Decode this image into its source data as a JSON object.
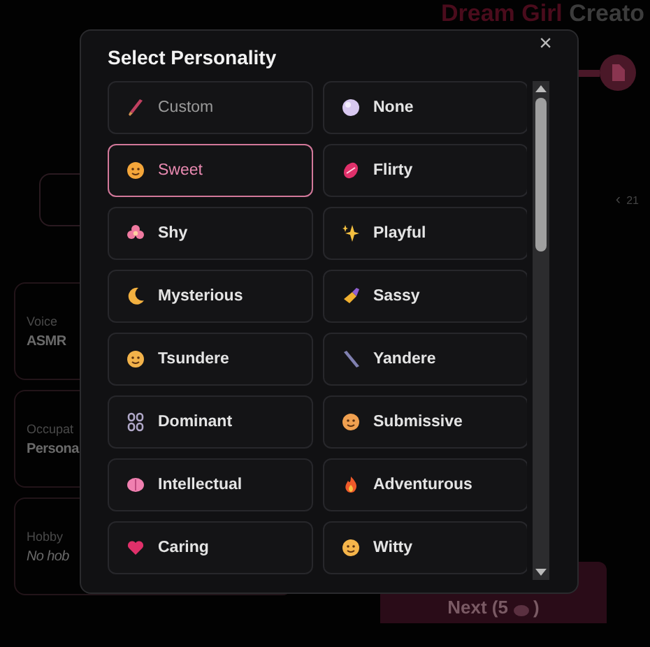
{
  "page": {
    "title_part1": "Dream Girl",
    "title_part2": "Creato",
    "pager": {
      "prev": "‹",
      "page": "21"
    },
    "fields": [
      {
        "label": "Voice",
        "value": "ASMR",
        "kind": "value"
      },
      {
        "label": "Occupat",
        "value": "Persona",
        "kind": "value"
      },
      {
        "label": "Hobby",
        "value": "No hob",
        "kind": "placeholder"
      }
    ],
    "next_button": {
      "label": "Next (5",
      "close": ")"
    }
  },
  "modal": {
    "title": "Select Personality",
    "close": "×",
    "options": [
      {
        "label": "Custom",
        "kind": "custom",
        "selected": false
      },
      {
        "label": "None",
        "kind": "option",
        "selected": false
      },
      {
        "label": "Sweet",
        "kind": "option",
        "selected": true
      },
      {
        "label": "Flirty",
        "kind": "option",
        "selected": false
      },
      {
        "label": "Shy",
        "kind": "option",
        "selected": false
      },
      {
        "label": "Playful",
        "kind": "option",
        "selected": false
      },
      {
        "label": "Mysterious",
        "kind": "option",
        "selected": false
      },
      {
        "label": "Sassy",
        "kind": "option",
        "selected": false
      },
      {
        "label": "Tsundere",
        "kind": "option",
        "selected": false
      },
      {
        "label": "Yandere",
        "kind": "option",
        "selected": false
      },
      {
        "label": "Dominant",
        "kind": "option",
        "selected": false
      },
      {
        "label": "Submissive",
        "kind": "option",
        "selected": false
      },
      {
        "label": "Intellectual",
        "kind": "option",
        "selected": false
      },
      {
        "label": "Adventurous",
        "kind": "option",
        "selected": false
      },
      {
        "label": "Caring",
        "kind": "option",
        "selected": false
      },
      {
        "label": "Witty",
        "kind": "option",
        "selected": false
      }
    ]
  }
}
